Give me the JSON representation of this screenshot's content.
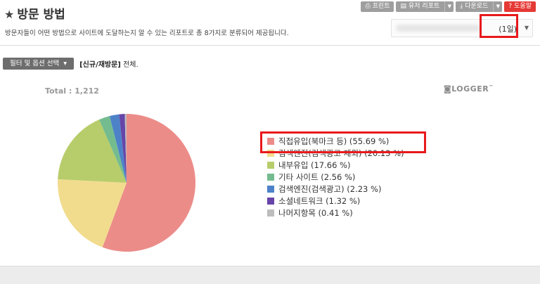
{
  "header": {
    "title": "방문 방법",
    "description": "방문자들이 어떤 방법으로 사이트에 도달하는지 알 수 있는 리포트로 총 8가지로 분류되어 제공됩니다."
  },
  "toolbar": {
    "print_label": "프린트",
    "my_report_label": "유저 리포트",
    "download_label": "다운로드",
    "help_label": "도움말"
  },
  "period": {
    "value": "(1일)"
  },
  "filter": {
    "button_label": "필터 및 옵션 선택",
    "option_label": "[신규/재방문]",
    "option_value": "전체."
  },
  "total_label": "Total : 1,212",
  "logo": {
    "text": "LOGGER"
  },
  "colors": {
    "highlight": "#e8191c"
  },
  "chart_data": {
    "type": "pie",
    "total": 1212,
    "slices": [
      {
        "label": "직접유입(북마크 등)",
        "value": 55.69,
        "display": "직접유입(북마크 등)  (55.69 %)",
        "color": "#ec8c89"
      },
      {
        "label": "검색엔진(검색광고 제외)",
        "value": 20.13,
        "display": "검색엔진(검색광고 제외)  (20.13 %)",
        "color": "#f1dc8e"
      },
      {
        "label": "내부유입",
        "value": 17.66,
        "display": "내부유입  (17.66 %)",
        "color": "#b7cd6b"
      },
      {
        "label": "기타 사이트",
        "value": 2.56,
        "display": "기타 사이트  (2.56 %)",
        "color": "#74bc8f"
      },
      {
        "label": "검색엔진(검색광고)",
        "value": 2.23,
        "display": "검색엔진(검색광고)  (2.23 %)",
        "color": "#4d82c8"
      },
      {
        "label": "소셜네트워크",
        "value": 1.32,
        "display": "소셜네트워크  (1.32 %)",
        "color": "#6745a8"
      },
      {
        "label": "나머지항목",
        "value": 0.41,
        "display": "나머지항목  (0.41 %)",
        "color": "#bdbdbd"
      }
    ]
  }
}
